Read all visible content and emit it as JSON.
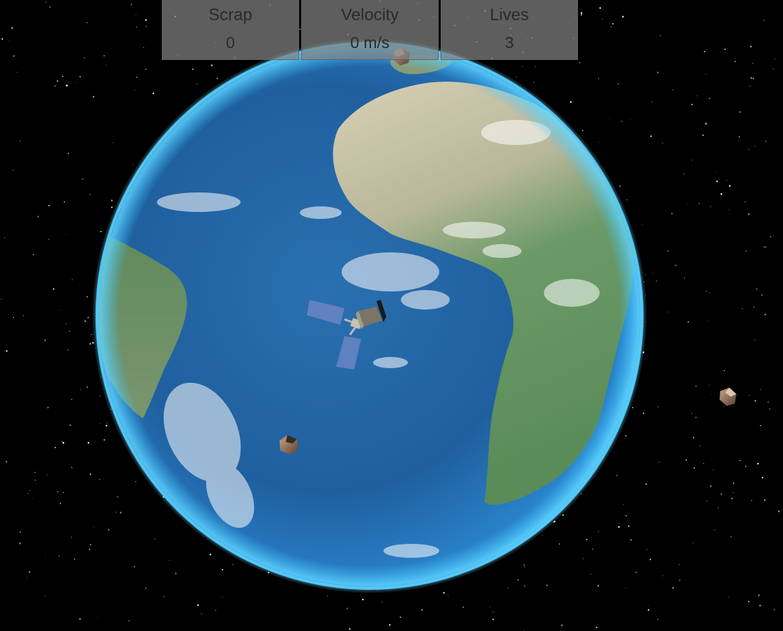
{
  "hud": {
    "scrap_label": "Scrap",
    "scrap_value": "0",
    "velocity_label": "Velocity",
    "velocity_value": "0 m/s",
    "lives_label": "Lives",
    "lives_value": "3"
  },
  "scene": {
    "planet": "earth",
    "player": "satellite",
    "debris_count": 3
  },
  "colors": {
    "space": "#000000",
    "ocean": "#1f5f9e",
    "atmosphere": "#3fc6ff",
    "land_green": "#5f8f5a",
    "land_desert": "#c9c3a6",
    "hud_panel": "#828282"
  }
}
